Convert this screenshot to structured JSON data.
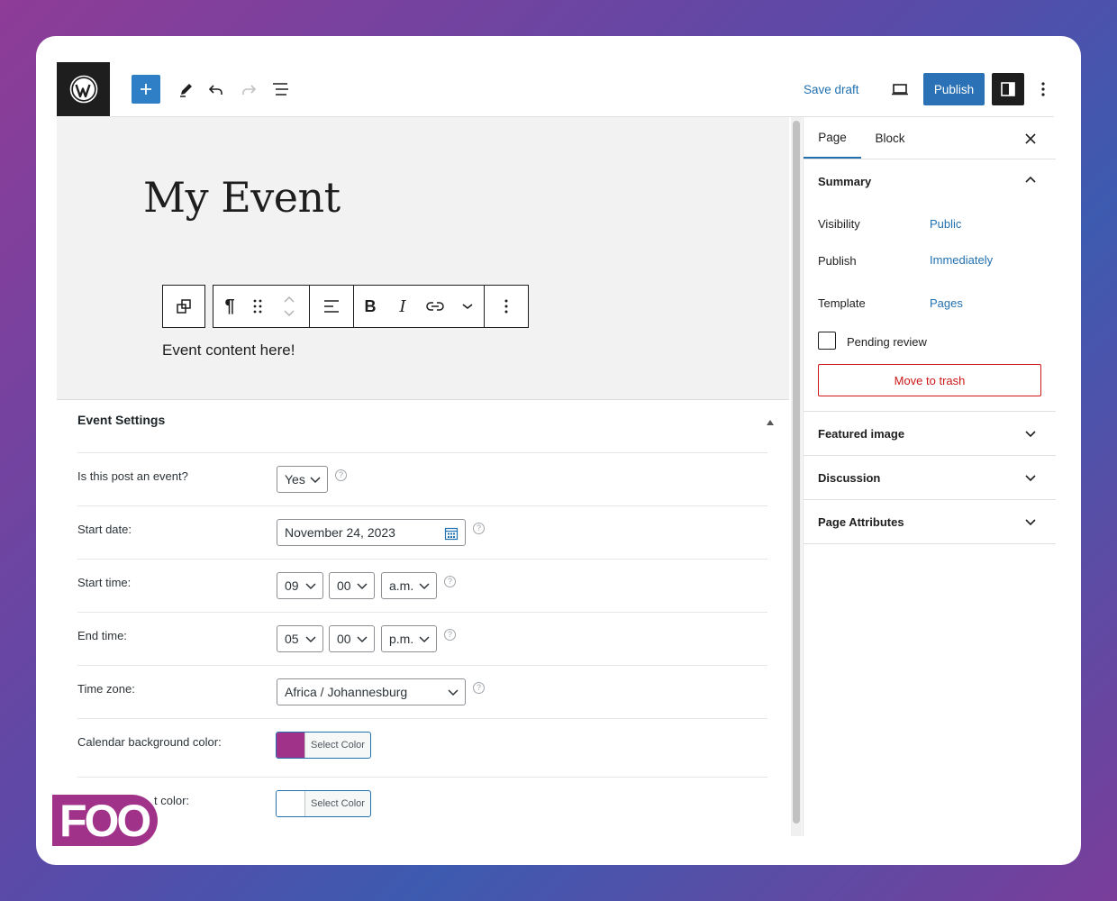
{
  "header": {
    "add_icon": "plus-icon",
    "tools_icon": "pencil-icon",
    "undo_icon": "undo-icon",
    "redo_icon": "redo-icon",
    "outline_icon": "list-view-icon",
    "save_draft": "Save draft",
    "preview_icon": "laptop-icon",
    "publish": "Publish",
    "settings_icon": "sidebar-toggle-icon",
    "options_icon": "more-vertical-icon"
  },
  "editor": {
    "title": "My Event",
    "paragraph": "Event content here!",
    "toolbar": {
      "bold": "B",
      "italic": "I",
      "paragraph_glyph": "¶"
    }
  },
  "meta_box": {
    "title": "Event Settings",
    "fields": {
      "is_event": {
        "label": "Is this post an event?",
        "value": "Yes"
      },
      "start_date": {
        "label": "Start date:",
        "value": "November 24, 2023"
      },
      "start_time": {
        "label": "Start time:",
        "hour": "09",
        "minute": "00",
        "ampm": "a.m."
      },
      "end_time": {
        "label": "End time:",
        "hour": "05",
        "minute": "00",
        "ampm": "p.m."
      },
      "time_zone": {
        "label": "Time zone:",
        "value": "Africa / Johannesburg"
      },
      "bg_color": {
        "label": "Calendar background color:",
        "button": "Select Color",
        "color": "#a1328a"
      },
      "text_color": {
        "label": "Calendar text color:",
        "visible_label": "t color:",
        "button": "Select Color",
        "color": "#ffffff"
      }
    }
  },
  "sidebar": {
    "tabs": [
      "Page",
      "Block"
    ],
    "summary": {
      "title": "Summary",
      "visibility_label": "Visibility",
      "visibility_value": "Public",
      "publish_label": "Publish",
      "publish_value": "Immediately",
      "template_label": "Template",
      "template_value": "Pages",
      "pending_review": "Pending review",
      "trash": "Move to trash"
    },
    "panels": [
      "Featured image",
      "Discussion",
      "Page Attributes"
    ]
  },
  "brand": {
    "foo_logo_text": "FOO",
    "accent": "#2271b1",
    "logo_color": "#a1328a"
  }
}
